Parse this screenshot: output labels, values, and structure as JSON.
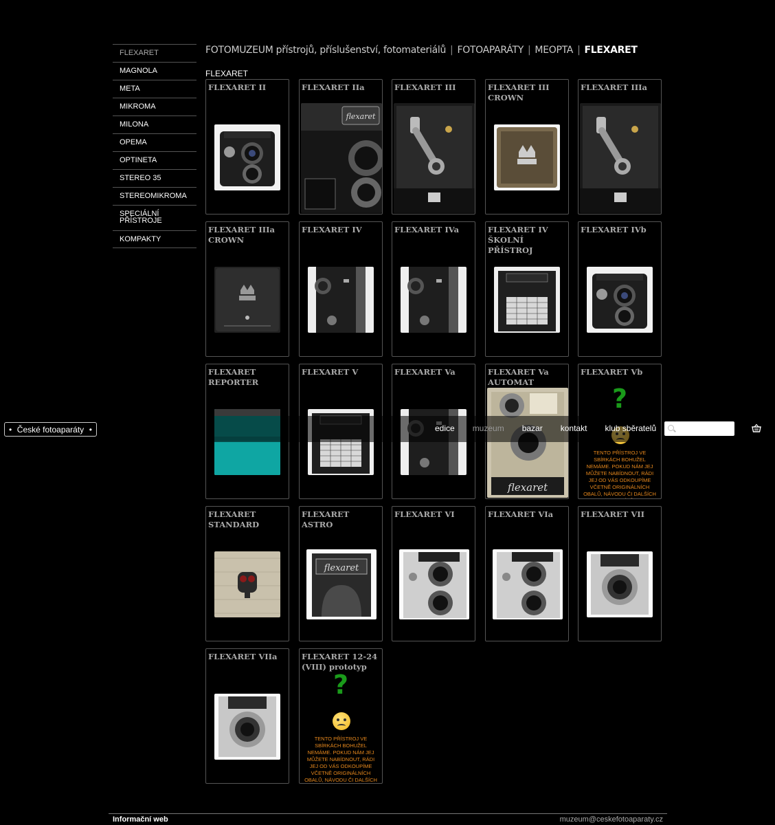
{
  "sidebar": {
    "items": [
      {
        "label": "FLEXARET",
        "active": true
      },
      {
        "label": "MAGNOLA"
      },
      {
        "label": "META"
      },
      {
        "label": "MIKROMA"
      },
      {
        "label": "MILONA"
      },
      {
        "label": "OPEMA"
      },
      {
        "label": "OPTINETA"
      },
      {
        "label": "STEREO 35"
      },
      {
        "label": "STEREOMIKROMA"
      },
      {
        "label": "SPECIÁLNÍ PŘÍSTROJE"
      },
      {
        "label": "KOMPAKTY"
      }
    ]
  },
  "breadcrumb": {
    "root": "FOTOMUZEUM přístrojů, příslušenství, fotomateriálů",
    "level1": "FOTOAPARÁTY",
    "level2": "MEOPTA",
    "current": "FLEXARET",
    "separator": "|"
  },
  "section_title": "FLEXARET",
  "cards": [
    {
      "title": "FLEXARET II",
      "thumb": "tlr-front-icon"
    },
    {
      "title": "FLEXARET IIa",
      "thumb": "tlr-detail-icon"
    },
    {
      "title": "FLEXARET III",
      "thumb": "crank-side-icon"
    },
    {
      "title": "FLEXARET III CROWN",
      "thumb": "crown-emblem-icon"
    },
    {
      "title": "FLEXARET IIIa",
      "thumb": "crank-side-icon"
    },
    {
      "title": "FLEXARET IIIa CROWN",
      "thumb": "crown-back-icon"
    },
    {
      "title": "FLEXARET IV",
      "thumb": "side-knob-icon"
    },
    {
      "title": "FLEXARET IVa",
      "thumb": "side-knob-icon"
    },
    {
      "title": "FLEXARET IV ŠKOLNÍ PŘÍSTROJ",
      "thumb": "table-plate-icon"
    },
    {
      "title": "FLEXARET IVb",
      "thumb": "tlr-front-icon"
    },
    {
      "title": "FLEXARET REPORTER",
      "thumb": "teal-box-icon"
    },
    {
      "title": "FLEXARET V",
      "thumb": "table-plate-icon"
    },
    {
      "title": "FLEXARET Va",
      "thumb": "side-knob-icon"
    },
    {
      "title": "FLEXARET Va AUTOMAT",
      "thumb": "tlr-automat-icon"
    },
    {
      "title": "FLEXARET Vb",
      "missing": true
    },
    {
      "title": "FLEXARET STANDARD",
      "thumb": "silver-plate-icon"
    },
    {
      "title": "FLEXARET ASTRO",
      "thumb": "hood-icon"
    },
    {
      "title": "FLEXARET VI",
      "thumb": "silver-tlr-icon"
    },
    {
      "title": "FLEXARET VIa",
      "thumb": "silver-tlr-icon"
    },
    {
      "title": "FLEXARET VII",
      "thumb": "silver-lens-icon"
    },
    {
      "title": "FLEXARET VIIa",
      "thumb": "silver-lens-icon"
    },
    {
      "title": "FLEXARET 12-24 (VIII) prototyp",
      "missing": true
    }
  ],
  "missing_text": "TENTO PŘÍSTROJ VE SBÍRKÁCH BOHUŽEL NEMÁME. POKUD NÁM JEJ MŮŽETE NABÍDNOUT, RÁDI JEJ OD VÁS ODKOUPÍME VČETNĚ ORIGINÁLNÍCH OBALŮ, NÁVODU ČI DALŠÍCH MATERIÁLŮ.",
  "missing_mark": "?",
  "navbar": {
    "brand_button": "České fotoaparáty",
    "links": [
      "edice",
      "muzeum",
      "bazar",
      "kontakt",
      "klub sběratelů"
    ],
    "search_placeholder": ""
  },
  "footer": {
    "left": "Informační web",
    "right": "muzeum@ceskefotoaparaty.cz"
  }
}
